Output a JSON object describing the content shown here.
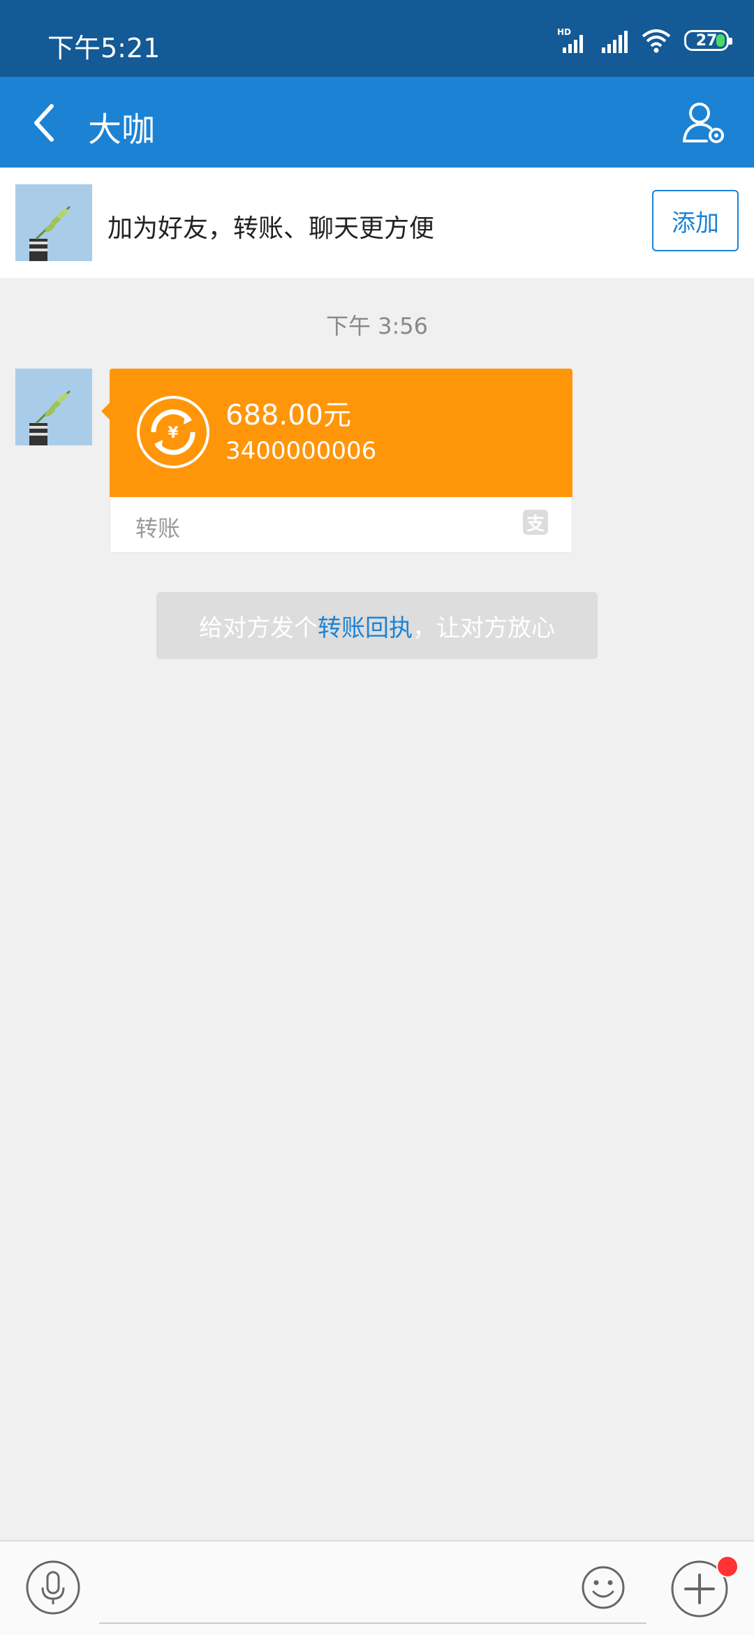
{
  "status_bar": {
    "time": "下午5:21",
    "battery": "27",
    "network_label": "HD"
  },
  "header": {
    "title": "大咖"
  },
  "banner": {
    "text": "加为好友，转账、聊天更方便",
    "add_label": "添加"
  },
  "chat": {
    "timestamp": "下午 3:56",
    "transfer": {
      "amount": "688.00元",
      "sub": "3400000006",
      "label": "转账",
      "brand_glyph": "支"
    },
    "notice": {
      "prefix": "给对方发个",
      "link": "转账回执",
      "suffix": "，让对方放心"
    }
  },
  "colors": {
    "accent": "#1c82d4",
    "status_bar": "#135a96",
    "transfer_orange": "#ff9609",
    "badge_red": "#ff3333"
  },
  "icons": [
    "back-arrow-icon",
    "profile-settings-icon",
    "mic-icon",
    "emoji-icon",
    "plus-icon",
    "transfer-yuan-icon",
    "alipay-icon"
  ]
}
